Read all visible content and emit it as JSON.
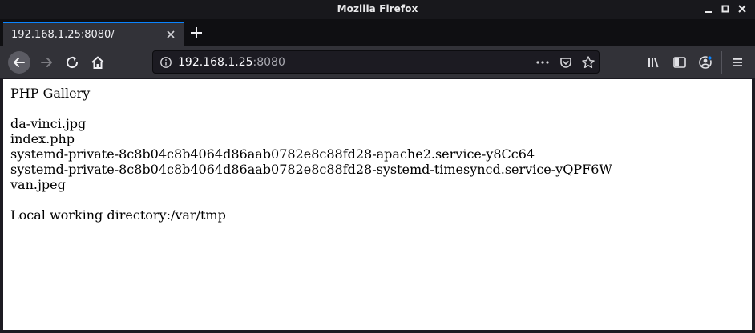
{
  "window": {
    "title": "Mozilla Firefox"
  },
  "tabs": [
    {
      "title": "192.168.1.25:8080/",
      "active": true
    }
  ],
  "urlbar": {
    "host": "192.168.1.25",
    "port": ":8080"
  },
  "page": {
    "heading": "PHP Gallery",
    "files": [
      "da-vinci.jpg",
      "index.php",
      "systemd-private-8c8b04c8b4064d86aab0782e8c88fd28-apache2.service-y8Cc64",
      "systemd-private-8c8b04c8b4064d86aab0782e8c88fd28-systemd-timesyncd.service-yQPF6W",
      "van.jpeg"
    ],
    "cwd_label": "Local working directory:/var/tmp"
  },
  "colors": {
    "accent": "#0a84ff",
    "chrome": "#323238",
    "titlebar": "#18181c"
  }
}
